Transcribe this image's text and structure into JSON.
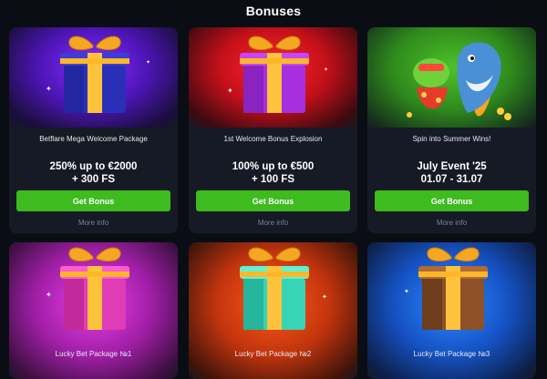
{
  "page": {
    "title": "Bonuses"
  },
  "cards": [
    {
      "name": "Betflare Mega Welcome Package",
      "offer_line1": "250% up to €2000",
      "offer_line2": "+ 300 FS",
      "button": "Get Bonus",
      "more": "More info"
    },
    {
      "name": "1st Welcome Bonus Explosion",
      "offer_line1": "100% up to €500",
      "offer_line2": "+ 100 FS",
      "button": "Get Bonus",
      "more": "More info"
    },
    {
      "name": "Spin into Summer Wins!",
      "offer_line1": "July Event '25",
      "offer_line2": "01.07 - 31.07",
      "button": "Get Bonus",
      "more": "More info"
    },
    {
      "name": "Lucky Bet Package №1"
    },
    {
      "name": "Lucky Bet Package №2"
    },
    {
      "name": "Lucky Bet Package №3"
    }
  ],
  "colors": {
    "button": "#3dbb1f",
    "page_background": "#0b0d14",
    "card_background": "#161a24"
  }
}
